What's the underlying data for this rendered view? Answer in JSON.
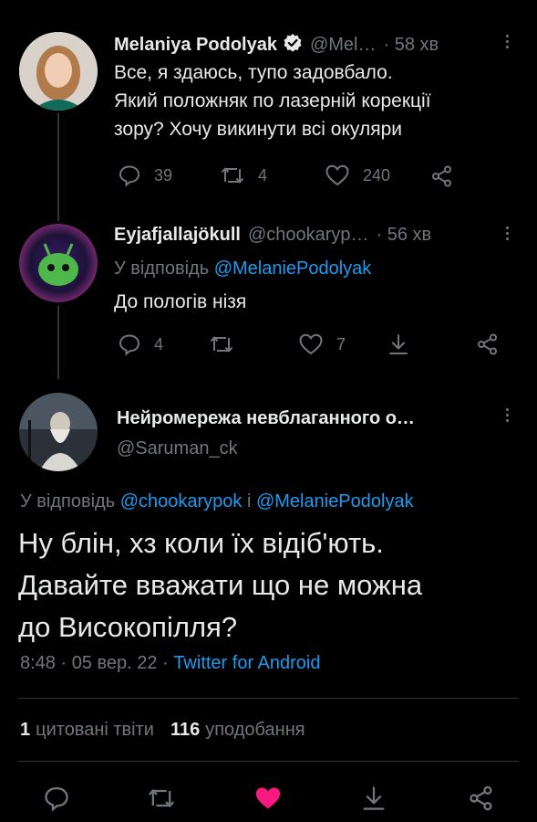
{
  "tweet1": {
    "name": "Melaniya Podolyak",
    "handle": "@Mel…",
    "time": "· 58 хв",
    "lines": [
      "Все, я здаюсь, тупо задовбало.",
      "Який положняк по лазерній корекції",
      "зору? Хочу викинути всі окуляри"
    ],
    "replies": "39",
    "retweets": "4",
    "likes": "240"
  },
  "tweet2": {
    "name": "Eyjafjallajökull",
    "handle": "@chookaryp…",
    "time": "· 56 хв",
    "reply_prefix": "У відповідь",
    "reply_link": "@MelaniePodolyak",
    "text": "До пологів нізя",
    "replies": "4",
    "likes": "7"
  },
  "tweet3": {
    "name": "Нейромережа невблаганного о…",
    "handle": "@Saruman_ck",
    "reply_prefix": "У відповідь",
    "reply_link1": "@chookarypok",
    "reply_and": "і",
    "reply_link2": "@MelaniePodolyak",
    "lines": [
      "Ну блін, хз коли їх відіб'ють.",
      "Давайте вважати що не можна",
      "до Високопілля?"
    ],
    "time": "8:48",
    "date": "05 вер. 22",
    "source": "Twitter for Android",
    "quotes_count": "1",
    "quotes_label": "цитовані твіти",
    "likes_count": "116",
    "likes_label": "уподобання"
  },
  "colors": {
    "accent": "#1d9bf0",
    "like": "#f91880",
    "muted": "#71767b"
  },
  "icons": [
    "verified-badge-icon",
    "reply-icon",
    "retweet-icon",
    "like-icon",
    "share-icon",
    "download-icon",
    "more-icon"
  ]
}
